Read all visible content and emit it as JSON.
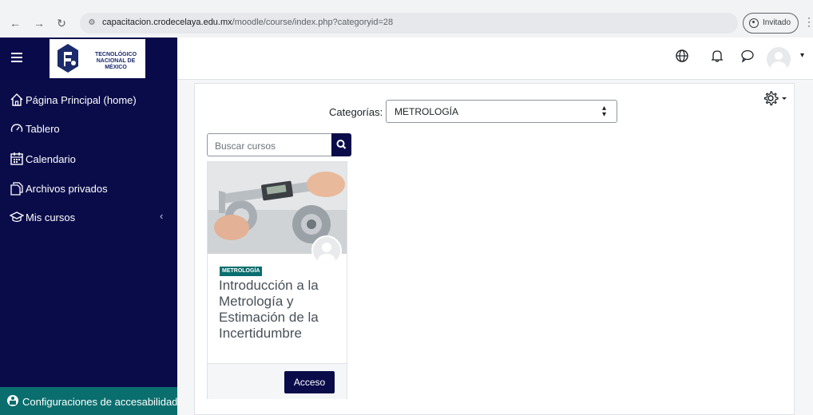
{
  "browser": {
    "url_domain": "capacitacion.crodecelaya.edu.mx",
    "url_path": "/moodle/course/index.php?categoryid=28",
    "profile_label": "Invitado"
  },
  "navbar": {
    "logo_text_line1": "TECNOLÓGICO",
    "logo_text_line2": "NACIONAL DE MÉXICO"
  },
  "sidebar": {
    "items": [
      {
        "label": "Página Principal (home)",
        "icon": "home-icon"
      },
      {
        "label": "Tablero",
        "icon": "dashboard-icon"
      },
      {
        "label": "Calendario",
        "icon": "calendar-icon"
      },
      {
        "label": "Archivos privados",
        "icon": "files-icon"
      },
      {
        "label": "Mis cursos",
        "icon": "graduation-cap-icon"
      }
    ],
    "accessibility_label": "Configuraciones de accesabilidad"
  },
  "main": {
    "categories_label": "Categorías:",
    "categories_selected": "METROLOGÍA",
    "search_placeholder": "Buscar cursos"
  },
  "course": {
    "category_badge": "METROLOGÍA",
    "title": "Introducción a la Metrología y Estimación de la Incertidumbre",
    "access_button": "Acceso"
  },
  "colors": {
    "sidebar_bg": "#0a0c4a",
    "accent_teal": "#0a6e6e",
    "button_bg": "#0a0c4a"
  }
}
